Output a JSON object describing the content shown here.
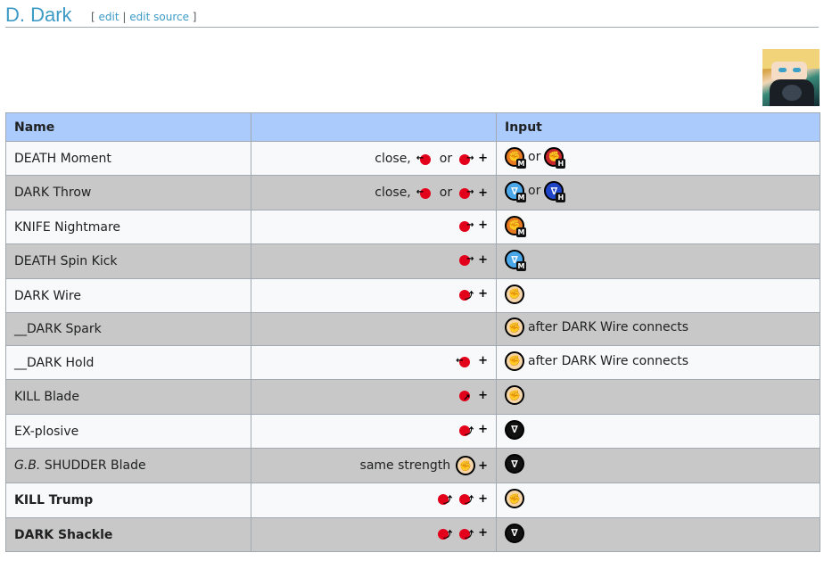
{
  "section": {
    "title": "D. Dark",
    "edit_open": "[",
    "edit_label": "edit",
    "sep": "|",
    "edit_source_label": "edit source",
    "edit_close": "]"
  },
  "table": {
    "headers": {
      "name": "Name",
      "motion": "",
      "input": "Input"
    },
    "or": "or",
    "after_wire": "after DARK Wire connects",
    "rows": [
      {
        "name": "DEATH Moment",
        "prefix": "close,",
        "motion": [
          "back-stick",
          "forward-stick"
        ],
        "buttons": [
          "punch-m",
          "punch-h"
        ]
      },
      {
        "name": "DARK Throw",
        "prefix": "close,",
        "motion": [
          "back-stick",
          "forward-stick"
        ],
        "buttons": [
          "kick-m",
          "kick-h"
        ]
      },
      {
        "name": "KNIFE Nightmare",
        "prefix": "",
        "motion": [
          "forward-stick"
        ],
        "buttons": [
          "punch-m"
        ]
      },
      {
        "name": "DEATH Spin Kick",
        "prefix": "",
        "motion": [
          "forward-stick"
        ],
        "buttons": [
          "kick-m"
        ]
      },
      {
        "name": "DARK Wire",
        "prefix": "",
        "motion": [
          "qcf-stick"
        ],
        "buttons": [
          "punch"
        ]
      },
      {
        "name": "__DARK Spark",
        "prefix": "",
        "motion": [],
        "buttons": [
          "punch"
        ]
      },
      {
        "name": "__DARK Hold",
        "prefix": "",
        "motion": [
          "back-stick"
        ],
        "buttons": [
          "punch"
        ]
      },
      {
        "name": "KILL Blade",
        "prefix": "",
        "motion": [
          "dp-stick"
        ],
        "buttons": [
          "punch"
        ]
      },
      {
        "name": "EX-plosive",
        "prefix": "",
        "motion": [
          "qcf-stick"
        ],
        "buttons": [
          "kick"
        ]
      },
      {
        "name_italic": "G.B.",
        "name": "SHUDDER Blade",
        "prefix": "same strength",
        "motion": [],
        "buttons": [
          "kick"
        ]
      },
      {
        "name": "KILL Trump",
        "prefix": "",
        "motion": [
          "qcf-stick",
          "qcf-stick"
        ],
        "buttons": [
          "punch"
        ]
      },
      {
        "name": "DARK Shackle",
        "prefix": "",
        "motion": [
          "qcf-stick",
          "qcf-stick"
        ],
        "buttons": [
          "kick"
        ]
      }
    ]
  }
}
